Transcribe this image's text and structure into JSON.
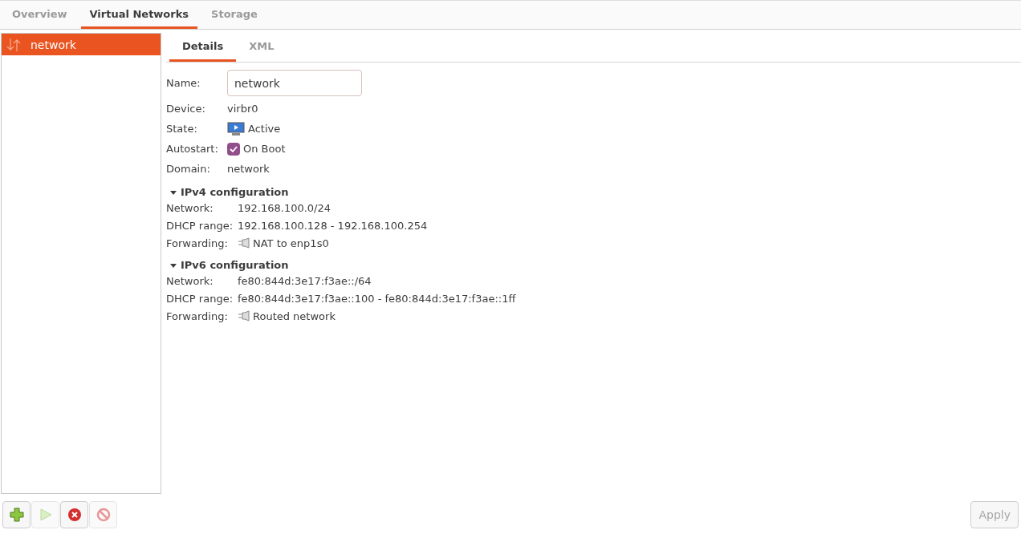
{
  "tabs": [
    {
      "label": "Overview",
      "selected": false
    },
    {
      "label": "Virtual Networks",
      "selected": true
    },
    {
      "label": "Storage",
      "selected": false
    }
  ],
  "networks": [
    {
      "name": "network",
      "selected": true
    }
  ],
  "subtabs": [
    {
      "label": "Details",
      "selected": true
    },
    {
      "label": "XML",
      "selected": false
    }
  ],
  "details": [
    {
      "kind": "input",
      "label": "Name:",
      "value": "network"
    },
    {
      "kind": "text",
      "label": "Device:",
      "value": "virbr0"
    },
    {
      "kind": "state",
      "label": "State:",
      "value": "Active"
    },
    {
      "kind": "checkbox",
      "label": "Autostart:",
      "value": "On Boot",
      "checked": true
    },
    {
      "kind": "text",
      "label": "Domain:",
      "value": "network"
    }
  ],
  "sections": [
    {
      "title": "IPv4 configuration",
      "expanded": true,
      "rows": [
        {
          "kind": "text",
          "label": "Network:",
          "value": "192.168.100.0/24"
        },
        {
          "kind": "text",
          "label": "DHCP range:",
          "value": "192.168.100.128 - 192.168.100.254"
        },
        {
          "kind": "forward",
          "label": "Forwarding:",
          "value": "NAT to enp1s0"
        }
      ]
    },
    {
      "title": "IPv6 configuration",
      "expanded": true,
      "rows": [
        {
          "kind": "text",
          "label": "Network:",
          "value": "fe80:844d:3e17:f3ae::/64"
        },
        {
          "kind": "text",
          "label": "DHCP range:",
          "value": "fe80:844d:3e17:f3ae::100 - fe80:844d:3e17:f3ae::1ff"
        },
        {
          "kind": "forward",
          "label": "Forwarding:",
          "value": "Routed network"
        }
      ]
    }
  ],
  "toolbar": [
    {
      "kind": "add",
      "disabled": false
    },
    {
      "kind": "start",
      "disabled": true
    },
    {
      "kind": "stop",
      "disabled": false
    },
    {
      "kind": "delete",
      "disabled": true
    }
  ],
  "apply": {
    "label": "Apply",
    "disabled": true
  }
}
